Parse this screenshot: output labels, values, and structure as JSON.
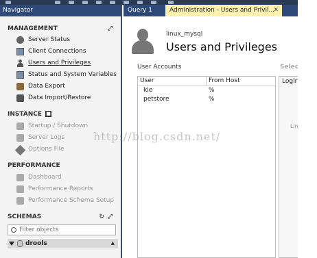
{
  "navigator": {
    "title": "Navigator",
    "management": {
      "title": "MANAGEMENT",
      "items": [
        {
          "label": "Server Status",
          "icon": "play-circle-icon"
        },
        {
          "label": "Client Connections",
          "icon": "monitor-icon"
        },
        {
          "label": "Users and Privileges",
          "icon": "user-icon"
        },
        {
          "label": "Status and System Variables",
          "icon": "variables-icon"
        },
        {
          "label": "Data Export",
          "icon": "export-icon"
        },
        {
          "label": "Data Import/Restore",
          "icon": "import-icon"
        }
      ]
    },
    "instance": {
      "title": "INSTANCE",
      "items": [
        {
          "label": "Startup / Shutdown",
          "icon": "power-icon"
        },
        {
          "label": "Server Logs",
          "icon": "logs-icon"
        },
        {
          "label": "Options File",
          "icon": "wrench-icon"
        }
      ]
    },
    "performance": {
      "title": "PERFORMANCE",
      "items": [
        {
          "label": "Dashboard",
          "icon": "dashboard-icon"
        },
        {
          "label": "Performance Reports",
          "icon": "reports-icon"
        },
        {
          "label": "Performance Schema Setup",
          "icon": "schema-setup-icon"
        }
      ]
    },
    "schemas": {
      "title": "SCHEMAS",
      "filter_placeholder": "Filter objects",
      "items": [
        {
          "label": "drools"
        }
      ]
    }
  },
  "tabs": [
    {
      "label": "Query 1",
      "active": false
    },
    {
      "label": "Administration - Users and Privil...",
      "active": true
    }
  ],
  "content": {
    "connection_name": "linux_mysql",
    "title": "Users and Privileges",
    "accounts_label": "User Accounts",
    "select_label": "Selec",
    "table": {
      "headers": [
        "User",
        "From Host"
      ],
      "rows": [
        [
          "kie",
          "%"
        ],
        [
          "petstore",
          "%"
        ]
      ]
    },
    "right_panel": {
      "tab": "Logir",
      "hint": "Lim"
    }
  },
  "watermark": "http://blog.csdn.net/",
  "colors": {
    "header_bg": "#2f4a78",
    "active_tab_bg": "#fff2b0"
  }
}
